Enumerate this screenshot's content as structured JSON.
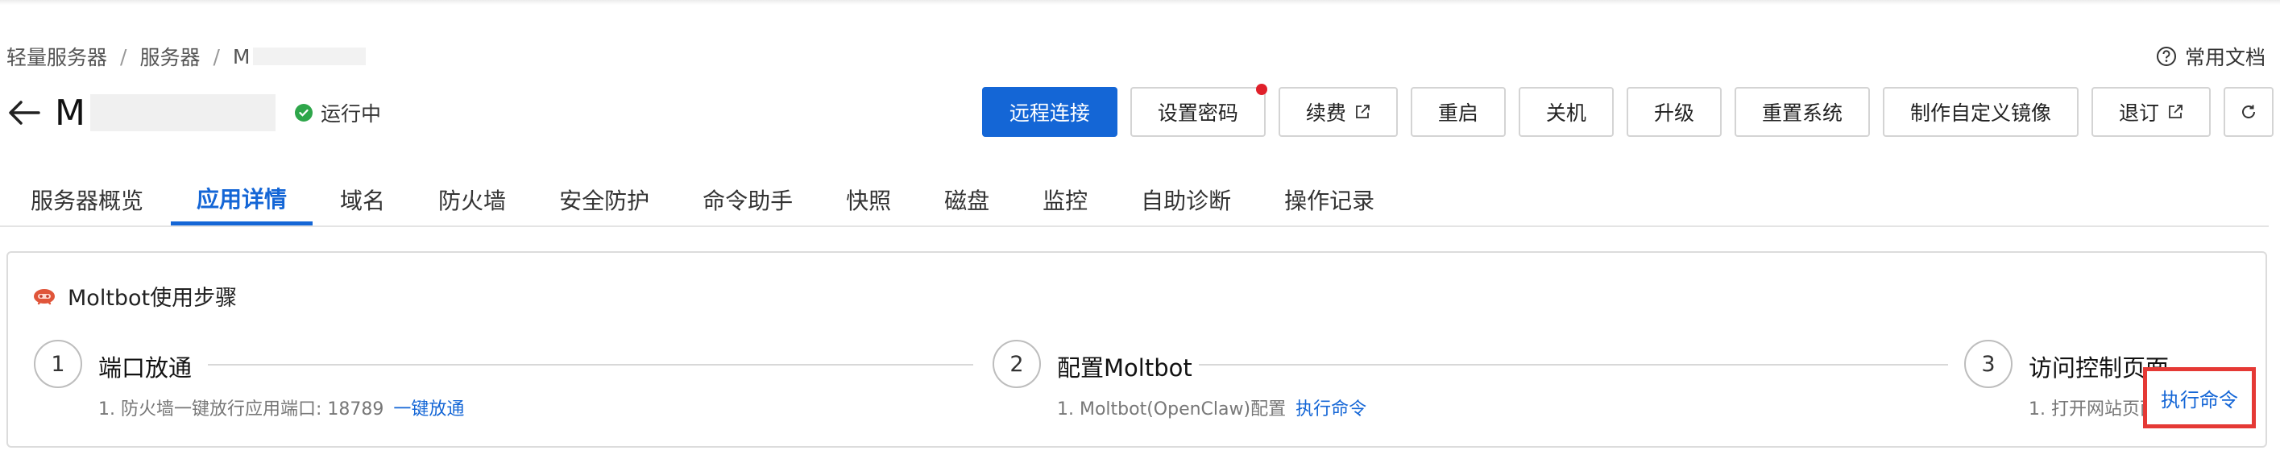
{
  "breadcrumb": {
    "items": [
      "轻量服务器",
      "服务器",
      "M"
    ],
    "separator": "/"
  },
  "help": {
    "label": "常用文档"
  },
  "header": {
    "title_prefix": "M",
    "status_label": "运行中",
    "status_color": "#2ea64a"
  },
  "actions": {
    "remote": "远程连接",
    "password": "设置密码",
    "renew": "续费",
    "restart": "重启",
    "shutdown": "关机",
    "upgrade": "升级",
    "reset": "重置系统",
    "image": "制作自定义镜像",
    "refund": "退订"
  },
  "tabs": [
    "服务器概览",
    "应用详情",
    "域名",
    "防火墙",
    "安全防护",
    "命令助手",
    "快照",
    "磁盘",
    "监控",
    "自助诊断",
    "操作记录"
  ],
  "active_tab": "应用详情",
  "card": {
    "title": "Moltbot使用步骤",
    "steps": [
      {
        "number": "1",
        "title": "端口放通",
        "desc": "1. 防火墙一键放行应用端口: 18789",
        "link": "一键放通"
      },
      {
        "number": "2",
        "title": "配置Moltbot",
        "desc": "1. Moltbot(OpenClaw)配置",
        "link": "执行命令"
      },
      {
        "number": "3",
        "title": "访问控制页面",
        "desc": "1. 打开网站页面",
        "link": "执行命令"
      }
    ]
  },
  "colors": {
    "accent": "#1466d6",
    "highlight": "#e53935",
    "notify_dot": "#e0202a"
  }
}
